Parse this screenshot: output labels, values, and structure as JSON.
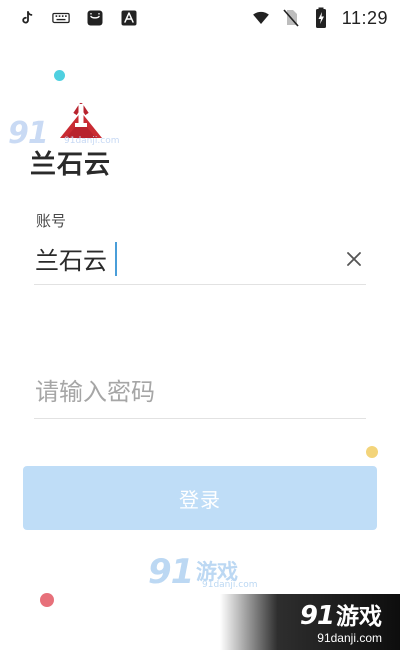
{
  "status_bar": {
    "time": "11:29",
    "left_icons": [
      "tiktok-icon",
      "keyboard-icon",
      "smile-app-icon",
      "text-app-icon"
    ],
    "right_icons": [
      "wifi-icon",
      "no-sim-icon",
      "battery-charging-icon"
    ]
  },
  "app": {
    "name": "兰石云"
  },
  "form": {
    "account_label": "账号",
    "account_value": "兰石云",
    "password_placeholder": "请输入密码",
    "login_label": "登录"
  },
  "watermarks": {
    "top_number": "91",
    "top_site": "91danji.com",
    "mid_number": "91",
    "mid_name": "游戏",
    "mid_site": "91danji.com",
    "brand_number": "91",
    "brand_name": "游戏",
    "brand_site": "91danji.com"
  },
  "colors": {
    "login_button": "#bfddf7",
    "input_caret": "#4a9ed9",
    "logo_red": "#b8232e"
  }
}
